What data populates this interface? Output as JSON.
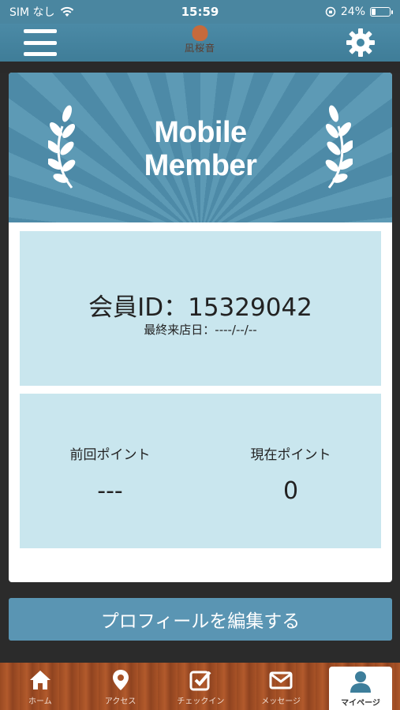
{
  "status_bar": {
    "carrier": "SIM なし",
    "time": "15:59",
    "battery_percent_label": "24%",
    "battery_level": 0.24
  },
  "header": {
    "logo_text": "凪桜音"
  },
  "banner": {
    "title_line1": "Mobile",
    "title_line2": "Member"
  },
  "member": {
    "id_label": "会員ID：15329042",
    "last_visit_label": "最終来店日：----/--/--"
  },
  "points": {
    "previous_label": "前回ポイント",
    "previous_value": "---",
    "current_label": "現在ポイント",
    "current_value": "0"
  },
  "edit_profile_label": "プロフィールを編集する",
  "tabs": [
    {
      "label": "ホーム",
      "icon": "home-icon",
      "active": false
    },
    {
      "label": "アクセス",
      "icon": "map-pin-icon",
      "active": false
    },
    {
      "label": "チェックイン",
      "icon": "checkbox-icon",
      "active": false
    },
    {
      "label": "メッセージ",
      "icon": "envelope-icon",
      "active": false
    },
    {
      "label": "マイページ",
      "icon": "user-icon",
      "active": true
    }
  ],
  "colors": {
    "header": "#4a86a0",
    "panel": "#c9e6ee",
    "button": "#5a95b3",
    "tabbar_wood": "#a85327"
  }
}
